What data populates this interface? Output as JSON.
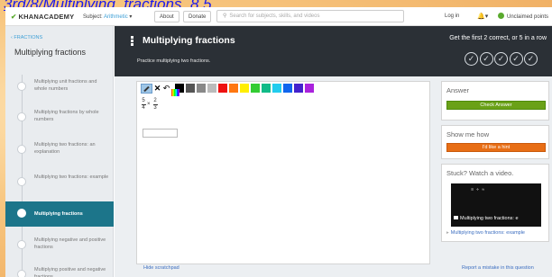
{
  "caption": "3rd/8/Multiplying_fractions_8.5",
  "topbar": {
    "logo": "KHANACADEMY",
    "subject_label": "Subject:",
    "subject_value": "Arithmetic",
    "about": "About",
    "donate": "Donate",
    "search_placeholder": "Search for subjects, skills, and videos",
    "login": "Log in",
    "unclaimed": "Unclaimed points"
  },
  "sidebar": {
    "back": "‹ FRACTIONS",
    "title": "Multiplying fractions",
    "items": [
      {
        "label": "Multiplying unit fractions and whole numbers",
        "active": false
      },
      {
        "label": "Multiplying fractions by whole numbers",
        "active": false
      },
      {
        "label": "Multiplying two fractions: an explanation",
        "active": false
      },
      {
        "label": "Multiplying two fractions: example",
        "active": false
      },
      {
        "label": "Multiplying fractions",
        "active": true
      },
      {
        "label": "Multiplying negative and positive fractions",
        "active": false
      },
      {
        "label": "Multiplying positive and negative fractions",
        "active": false
      }
    ]
  },
  "header": {
    "title": "Multiplying fractions",
    "subtitle": "Practice multiplying two fractions.",
    "goal": "Get the first 2 correct, or 5 in a row",
    "check_count": 5
  },
  "scratchpad": {
    "palette": [
      "#000000",
      "#555555",
      "#888888",
      "#bbbbbb",
      "#ee1111",
      "#ff7711",
      "#ffee00",
      "#33cc33",
      "#11bb88",
      "#22ccee",
      "#1166ee",
      "#4422cc",
      "#aa22dd"
    ],
    "problem": {
      "a_num": "5",
      "a_den": "4",
      "b_num": "2",
      "b_den": "3",
      "op": "×"
    },
    "hide_label": "Hide scratchpad",
    "report_label": "Report a mistake in this question"
  },
  "answer_panel": {
    "title": "Answer",
    "check_button": "Check Answer"
  },
  "hint_panel": {
    "title": "Show me how",
    "hint_button": "I'd like a hint"
  },
  "video_panel": {
    "title": "Stuck? Watch a video.",
    "thumb_label": "Multiplying two fractions: e",
    "link_label": "Multiplying two fractions: example"
  }
}
